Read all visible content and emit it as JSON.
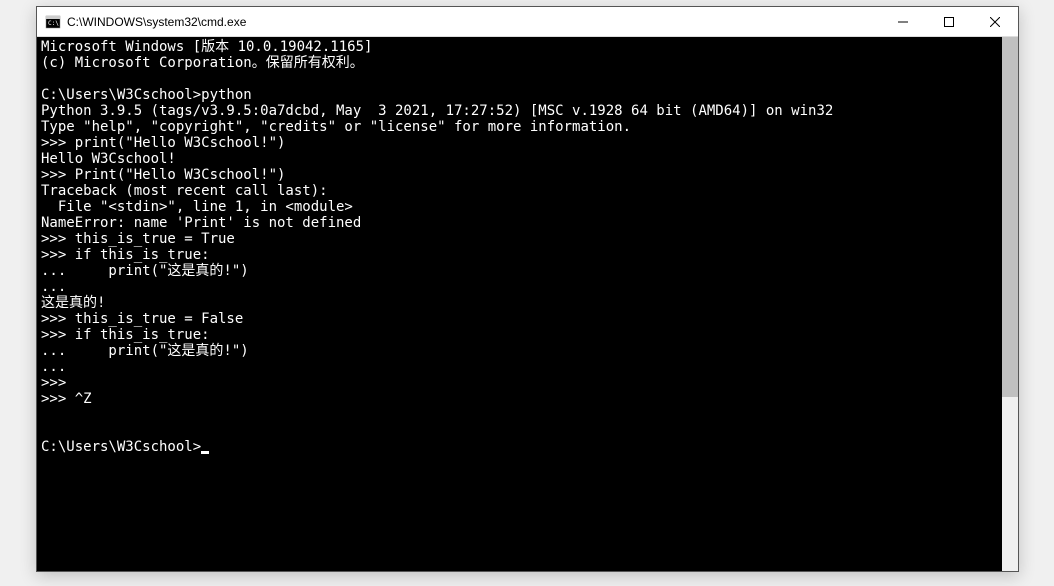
{
  "window": {
    "title": "C:\\WINDOWS\\system32\\cmd.exe"
  },
  "terminal": {
    "lines": [
      "Microsoft Windows [版本 10.0.19042.1165]",
      "(c) Microsoft Corporation。保留所有权利。",
      "",
      "C:\\Users\\W3Cschool>python",
      "Python 3.9.5 (tags/v3.9.5:0a7dcbd, May  3 2021, 17:27:52) [MSC v.1928 64 bit (AMD64)] on win32",
      "Type \"help\", \"copyright\", \"credits\" or \"license\" for more information.",
      ">>> print(\"Hello W3Cschool!\")",
      "Hello W3Cschool!",
      ">>> Print(\"Hello W3Cschool!\")",
      "Traceback (most recent call last):",
      "  File \"<stdin>\", line 1, in <module>",
      "NameError: name 'Print' is not defined",
      ">>> this_is_true = True",
      ">>> if this_is_true:",
      "...     print(\"这是真的!\")",
      "...",
      "这是真的!",
      ">>> this_is_true = False",
      ">>> if this_is_true:",
      "...     print(\"这是真的!\")",
      "...",
      ">>>",
      ">>> ^Z",
      "",
      "",
      "C:\\Users\\W3Cschool>"
    ],
    "prompt_cursor": true
  },
  "scrollbar": {
    "thumb_height": 360
  }
}
